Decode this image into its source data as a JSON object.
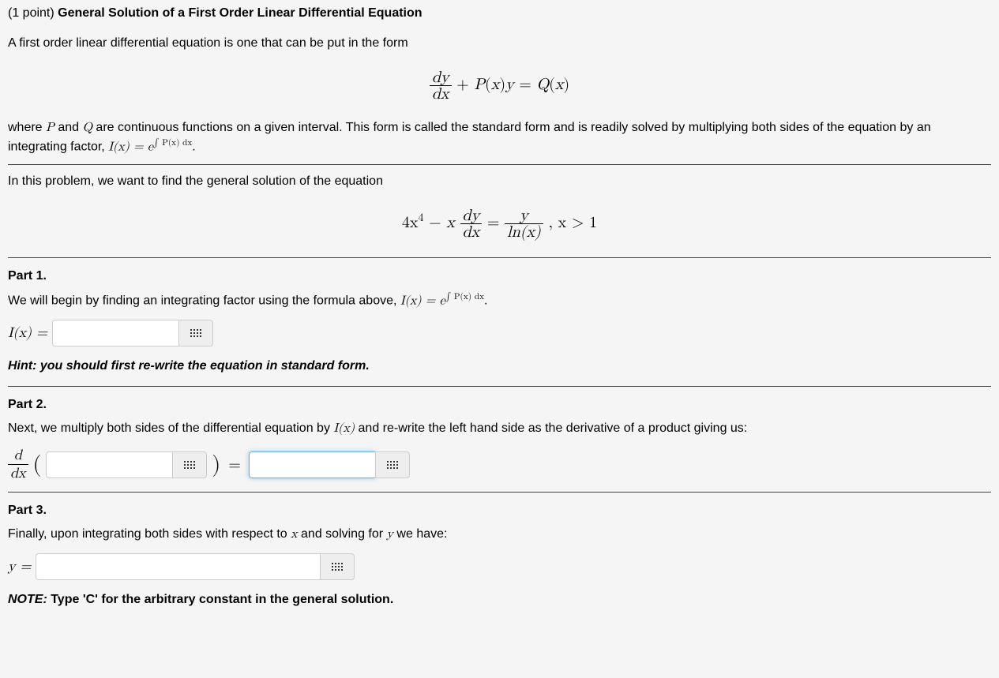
{
  "header": {
    "points_prefix": "(1 point) ",
    "title": "General Solution of a First Order Linear Differential Equation"
  },
  "intro": {
    "p1": "A first order linear differential equation is one that can be put in the form",
    "p2_a": "where ",
    "p2_b": " and ",
    "p2_c": " are continuous functions on a given interval. This form is called the standard form and is readily solved by multiplying both sides of the equation by an integrating factor, ",
    "p3": "In this problem, we want to find the general solution of the equation"
  },
  "eq1": {
    "frac_num": "dy",
    "frac_den": "dx",
    "plus": " + ",
    "P": "P",
    "open": "(",
    "x": "x",
    "close": ")",
    "y": "y",
    "eq": " = ",
    "Q": "Q"
  },
  "integrating_factor": {
    "Ix": "I(x) = e",
    "exp": "∫ P(x) dx",
    "dot": "."
  },
  "eq2": {
    "lhs1": "4x",
    "sup4": "4",
    "minus": " − ",
    "x": "x",
    "frac1_num": "dy",
    "frac1_den": "dx",
    "eq": " = ",
    "frac2_num": "y",
    "frac2_den": "ln(x)",
    "cond": " ,  x > 1"
  },
  "part1": {
    "title": "Part 1.",
    "text_a": "We will begin by finding an integrating factor using the formula above, ",
    "label": "I(x) = ",
    "hint": "Hint: you should first re-write the equation in standard form."
  },
  "part2": {
    "title": "Part 2.",
    "text_a": "Next, we multiply both sides of the differential equation by ",
    "text_b": " and re-write the left hand side as the derivative of a product giving us:",
    "dfrac_num": "d",
    "dfrac_den": "dx",
    "open": "(",
    "close": ")",
    "eq": " = "
  },
  "part3": {
    "title": "Part 3.",
    "text_a": "Finally, upon integrating both sides with respect to ",
    "text_b": " and solving for ",
    "text_c": " we have:",
    "label": "y = ",
    "note_label": "NOTE: ",
    "note_text": "Type 'C' for the arbitrary constant in the general solution."
  },
  "symbols": {
    "P": "P",
    "Q": "Q",
    "x": "x",
    "y": "y",
    "Ix": "I(x)"
  }
}
